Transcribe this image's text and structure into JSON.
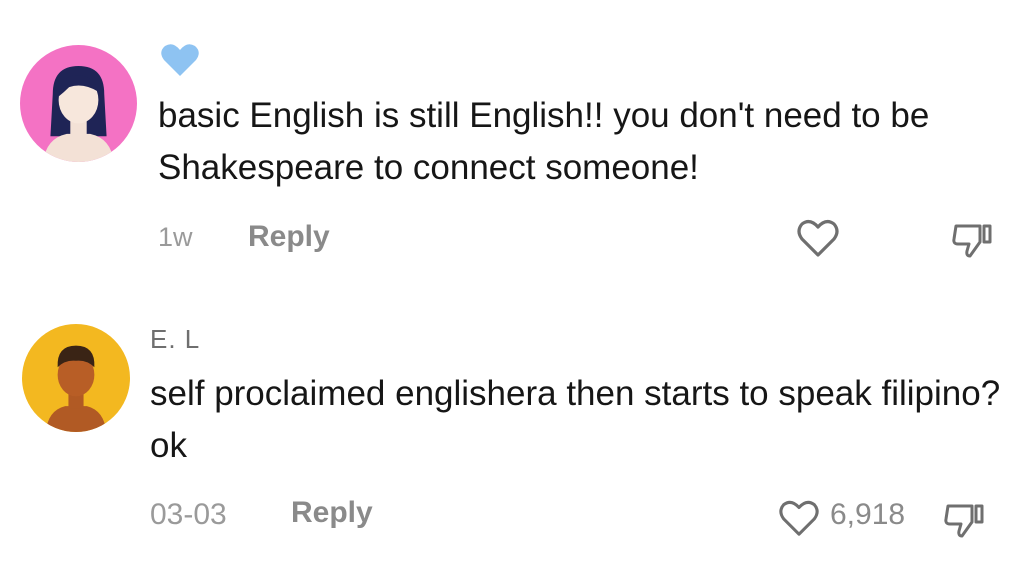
{
  "comments": [
    {
      "username": "",
      "username_icon": "blue-heart-icon",
      "avatar": "female-avatar-icon",
      "avatar_bg": "#f472c4",
      "text": "basic English is still English!! you don't need to be Shakespeare to connect someone!",
      "date": "1w",
      "reply_label": "Reply",
      "like_icon": "heart-outline-icon",
      "like_count": "",
      "dislike_icon": "thumbs-down-icon"
    },
    {
      "username": "E. L",
      "avatar": "male-avatar-icon",
      "avatar_bg": "#f3b820",
      "text": "self proclaimed englishera then starts to speak filipino? ok",
      "date": "03-03",
      "reply_label": "Reply",
      "like_icon": "heart-outline-icon",
      "like_count": "6,918",
      "dislike_icon": "thumbs-down-icon"
    }
  ],
  "colors": {
    "text": "#161616",
    "muted": "#8a8a8a",
    "icon_stroke": "#6f6f6f",
    "heart_blue": "#8ec3f2"
  }
}
